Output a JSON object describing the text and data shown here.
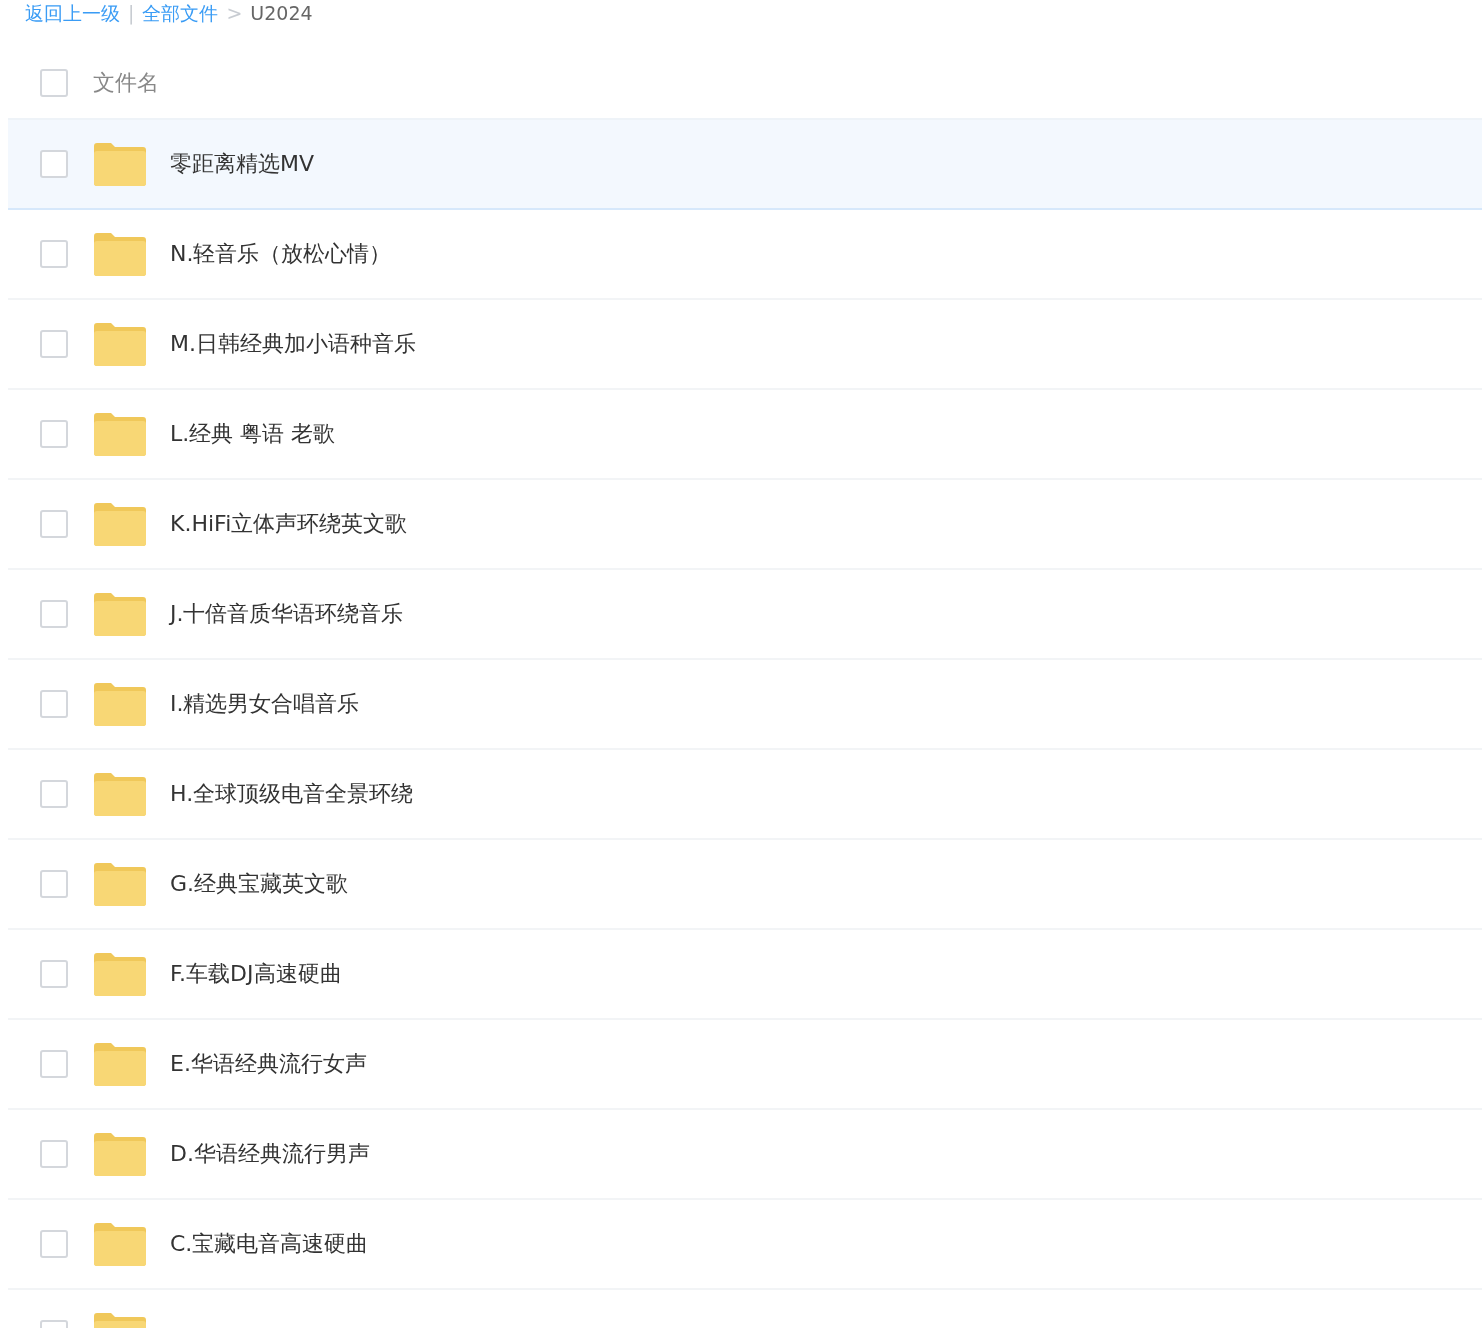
{
  "breadcrumb": [
    {
      "kind": "link",
      "text": "返回上一级"
    },
    {
      "kind": "sep",
      "text": "|"
    },
    {
      "kind": "link",
      "text": "全部文件"
    },
    {
      "kind": "sep",
      "text": ">"
    },
    {
      "kind": "current",
      "text": "U2024"
    }
  ],
  "header": {
    "label": "文件名",
    "checked": false
  },
  "rows": [
    {
      "name": "零距离精选MV",
      "checked": false,
      "selected": true
    },
    {
      "name": "N.轻音乐（放松心情）",
      "checked": false,
      "selected": false
    },
    {
      "name": "M.日韩经典加小语种音乐",
      "checked": false,
      "selected": false
    },
    {
      "name": "L.经典 粤语 老歌",
      "checked": false,
      "selected": false
    },
    {
      "name": "K.HiFi立体声环绕英文歌",
      "checked": false,
      "selected": false
    },
    {
      "name": "J.十倍音质华语环绕音乐",
      "checked": false,
      "selected": false
    },
    {
      "name": "I.精选男女合唱音乐",
      "checked": false,
      "selected": false
    },
    {
      "name": "H.全球顶级电音全景环绕",
      "checked": false,
      "selected": false
    },
    {
      "name": "G.经典宝藏英文歌",
      "checked": false,
      "selected": false
    },
    {
      "name": "F.车载DJ高速硬曲",
      "checked": false,
      "selected": false
    },
    {
      "name": "E.华语经典流行女声",
      "checked": false,
      "selected": false
    },
    {
      "name": "D.华语经典流行男声",
      "checked": false,
      "selected": false
    },
    {
      "name": "C.宝藏电音高速硬曲",
      "checked": false,
      "selected": false
    },
    {
      "checked": false,
      "selected": false
    }
  ]
}
